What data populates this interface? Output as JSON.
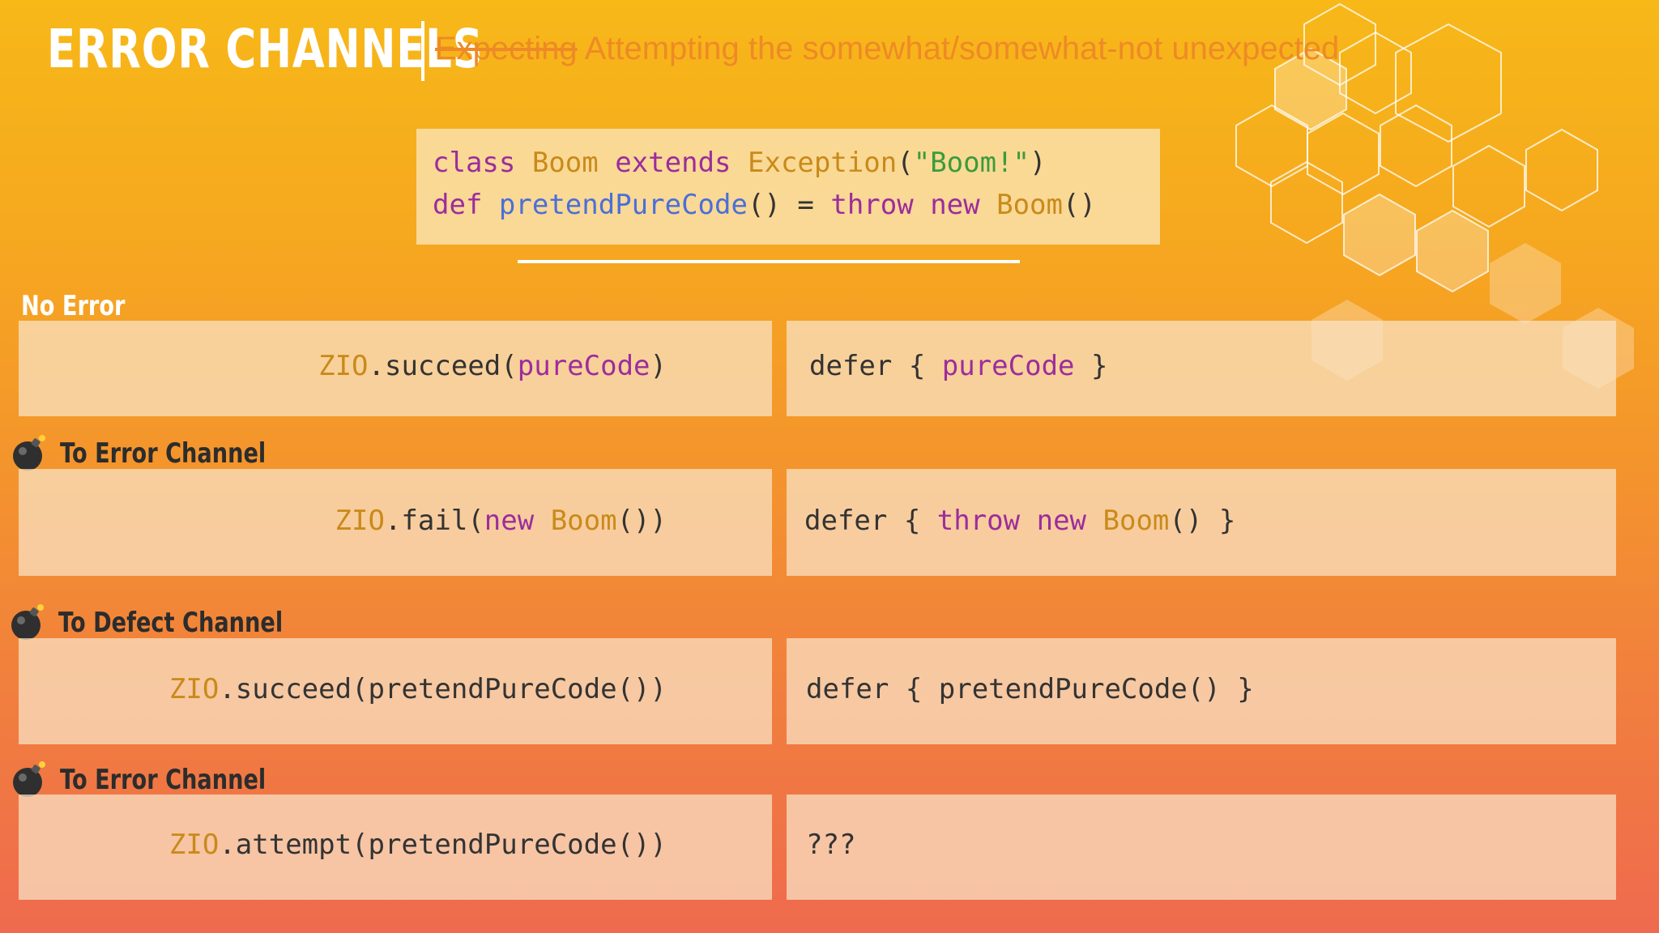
{
  "header": {
    "title": "ERROR CHANNELS",
    "subtitle_strike": "Expecting",
    "subtitle_rest": " Attempting the somewhat/somewhat-not unexpected"
  },
  "definition": {
    "line1": [
      "class",
      "Boom",
      "extends",
      "Exception",
      "(",
      "\"Boom!\"",
      ")"
    ],
    "line2": [
      "def",
      "pretendPureCode",
      "()",
      "=",
      "throw",
      "new",
      "Boom",
      "()"
    ]
  },
  "rows": [
    {
      "label": "No Error",
      "icon": "",
      "left": [
        "ZIO",
        ".succeed(",
        "pureCode",
        ")"
      ],
      "right": [
        "defer { ",
        "pureCode",
        " }"
      ]
    },
    {
      "label": "To Error Channel",
      "icon": "bomb-icon",
      "left": [
        "ZIO",
        ".fail(",
        "new",
        "Boom",
        "())"
      ],
      "right": [
        "defer { ",
        "throw",
        "new",
        "Boom",
        "() }"
      ]
    },
    {
      "label": "To Defect Channel",
      "icon": "bomb-icon",
      "left": [
        "ZIO",
        ".succeed(pretendPureCode())"
      ],
      "right": [
        "defer { pretendPureCode() }"
      ]
    },
    {
      "label": "To Error Channel",
      "icon": "bomb-icon",
      "left": [
        "ZIO",
        ".attempt(pretendPureCode())"
      ],
      "right": [
        "???"
      ]
    }
  ],
  "colors": {
    "keyword": "#9c2d9c",
    "type": "#c98a1a",
    "string": "#3a9c3a",
    "function": "#4a6fd8",
    "subtitle": "#ee8a26"
  }
}
